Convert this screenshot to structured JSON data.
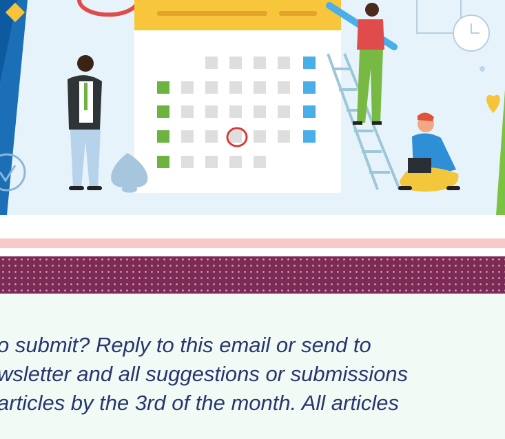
{
  "colors": {
    "hero_bg": "#e7f3fb",
    "pink_band": "#f6c9cb",
    "plum_band": "#7d2a55",
    "text": "#26366f",
    "body_bg": "#f2faf5"
  },
  "hero": {
    "illustration": "calendar-scheduling-illustration",
    "calendar_marker": "circled-date"
  },
  "notice": {
    "lines": [
      "o submit? Reply to this email or send to",
      "wsletter and all suggestions or submissions",
      " articles by the 3rd of the month. All articles"
    ]
  }
}
